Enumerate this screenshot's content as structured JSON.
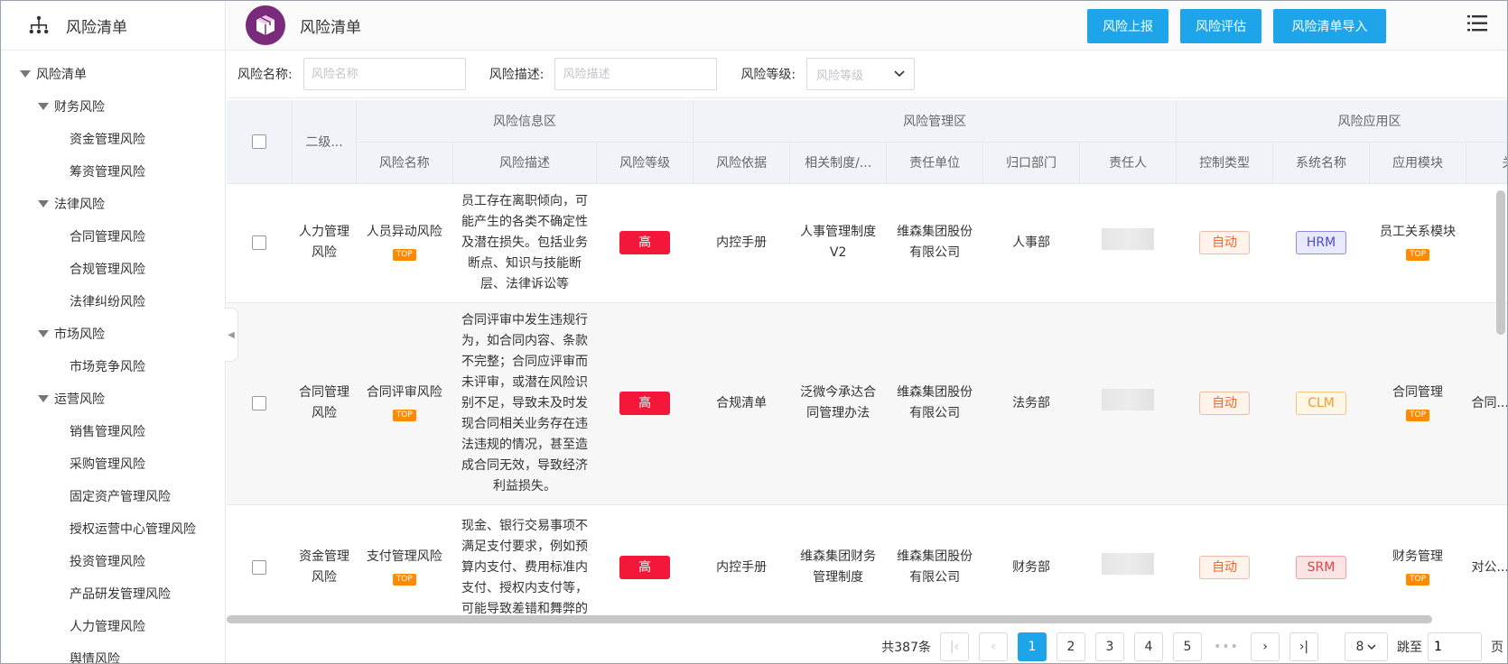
{
  "sidebar": {
    "title": "风险清单",
    "tree": [
      {
        "label": "风险清单",
        "level": 0,
        "expanded": true
      },
      {
        "label": "财务风险",
        "level": 1,
        "expanded": true
      },
      {
        "label": "资金管理风险",
        "level": 2
      },
      {
        "label": "筹资管理风险",
        "level": 2
      },
      {
        "label": "法律风险",
        "level": 1,
        "expanded": true
      },
      {
        "label": "合同管理风险",
        "level": 2
      },
      {
        "label": "合规管理风险",
        "level": 2
      },
      {
        "label": "法律纠纷风险",
        "level": 2
      },
      {
        "label": "市场风险",
        "level": 1,
        "expanded": true
      },
      {
        "label": "市场竞争风险",
        "level": 2
      },
      {
        "label": "运营风险",
        "level": 1,
        "expanded": true
      },
      {
        "label": "销售管理风险",
        "level": 2
      },
      {
        "label": "采购管理风险",
        "level": 2
      },
      {
        "label": "固定资产管理风险",
        "level": 2
      },
      {
        "label": "授权运营中心管理风险",
        "level": 2
      },
      {
        "label": "投资管理风险",
        "level": 2
      },
      {
        "label": "产品研发管理风险",
        "level": 2
      },
      {
        "label": "人力管理风险",
        "level": 2
      },
      {
        "label": "舆情风险",
        "level": 2
      }
    ]
  },
  "header": {
    "title": "风险清单",
    "buttons": {
      "report": "风险上报",
      "assess": "风险评估",
      "import": "风险清单导入"
    }
  },
  "filters": {
    "name_label": "风险名称:",
    "name_placeholder": "风险名称",
    "desc_label": "风险描述:",
    "desc_placeholder": "风险描述",
    "level_label": "风险等级:",
    "level_placeholder": "风险等级"
  },
  "table": {
    "groups": {
      "info": "风险信息区",
      "manage": "风险管理区",
      "apply": "风险应用区"
    },
    "columns": {
      "level2": "二级...",
      "name": "风险名称",
      "desc": "风险描述",
      "level": "风险等级",
      "basis": "风险依据",
      "system": "相关制度/...",
      "unit": "责任单位",
      "dept": "归口部门",
      "owner": "责任人",
      "ctrl": "控制类型",
      "sysname": "系统名称",
      "module": "应用模块",
      "rel": "关..."
    },
    "top_tag": "TOP",
    "rows": [
      {
        "level2": "人力管理风险",
        "name": "人员异动风险",
        "desc": "员工存在离职倾向，可能产生的各类不确定性及潜在损失。包括业务断点、知识与技能断层、法律诉讼等",
        "level": "高",
        "basis": "内控手册",
        "system": "人事管理制度V2",
        "unit": "维森集团股份有限公司",
        "dept": "人事部",
        "ctrl": "自动",
        "sysname": "HRM",
        "sys_style": "s-hrm",
        "module": "员工关系模块",
        "rel": ""
      },
      {
        "level2": "合同管理风险",
        "name": "合同评审风险",
        "desc": "合同评审中发生违规行为，如合同内容、条款不完整；合同应评审而未评审，或潜在风险识别不足，导致未及时发现合同相关业务存在违法违规的情况，甚至造成合同无效，导致经济利益损失。",
        "level": "高",
        "basis": "合规清单",
        "system": "泛微今承达合同管理办法",
        "unit": "维森集团股份有限公司",
        "dept": "法务部",
        "ctrl": "自动",
        "sysname": "CLM",
        "sys_style": "s-clm",
        "module": "合同管理",
        "rel": "合同..."
      },
      {
        "level2": "资金管理风险",
        "name": "支付管理风险",
        "desc": "现金、银行交易事项不满足支付要求，例如预算内支付、费用标准内支付、授权内支付等，可能导致差错和舞弊的",
        "level": "高",
        "basis": "内控手册",
        "system": "维森集团财务管理制度",
        "unit": "维森集团股份有限公司",
        "dept": "财务部",
        "ctrl": "自动",
        "sysname": "SRM",
        "sys_style": "s-srm",
        "module": "财务管理",
        "rel": "对公..."
      }
    ]
  },
  "pagination": {
    "total": "共387条",
    "pages": [
      "1",
      "2",
      "3",
      "4",
      "5"
    ],
    "active": "1",
    "ellipsis": "•••",
    "page_size": "8",
    "jump_label": "跳至",
    "jump_value": "1",
    "page_unit": "页"
  },
  "colors": {
    "primary": "#1ea5e9",
    "high": "#f5173a",
    "top_tag": "#ff8a00",
    "logo": "#7a2a7a"
  }
}
